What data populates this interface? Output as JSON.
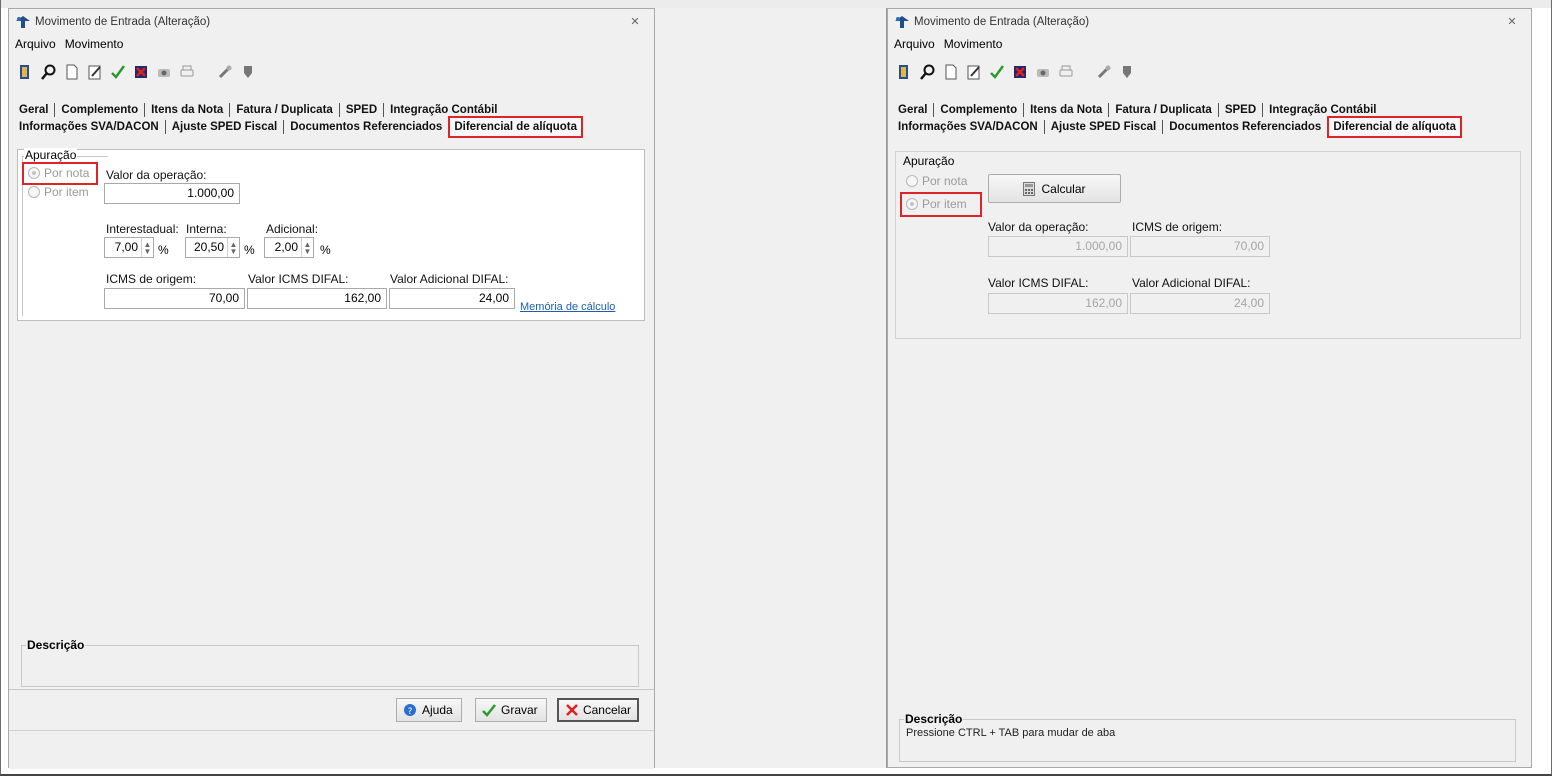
{
  "windows": {
    "left": {
      "title": "Movimento de Entrada (Alteração)",
      "menu": [
        "Arquivo",
        "Movimento"
      ],
      "tabs_row1": [
        "Geral",
        "Complemento",
        "Itens da Nota",
        "Fatura / Duplicata",
        "SPED",
        "Integração Contábil"
      ],
      "tabs_row2": [
        "Informações SVA/DACON",
        "Ajuste SPED Fiscal",
        "Documentos Referenciados",
        "Diferencial de alíquota"
      ],
      "group_label": "Apuração",
      "radio_por_nota": "Por nota",
      "radio_por_item": "Por item",
      "selected_radio": "Por nota",
      "label_valor_operacao": "Valor da operação:",
      "valor_operacao": "1.000,00",
      "label_interestadual": "Interestadual:",
      "interestadual": "7,00",
      "label_interna": "Interna:",
      "interna": "20,50",
      "label_adicional": "Adicional:",
      "adicional": "2,00",
      "percent_sign": "%",
      "label_icms_origem": "ICMS de origem:",
      "icms_origem": "70,00",
      "label_valor_icms_difal": "Valor ICMS DIFAL:",
      "valor_icms_difal": "162,00",
      "label_valor_adicional_difal": "Valor Adicional DIFAL:",
      "valor_adicional_difal": "24,00",
      "memoria_link": "Memória de cálculo",
      "descricao_title": "Descrição",
      "btn_ajuda": "Ajuda",
      "btn_gravar": "Gravar",
      "btn_cancelar": "Cancelar"
    },
    "right": {
      "title": "Movimento de Entrada (Alteração)",
      "menu": [
        "Arquivo",
        "Movimento"
      ],
      "tabs_row1": [
        "Geral",
        "Complemento",
        "Itens da Nota",
        "Fatura / Duplicata",
        "SPED",
        "Integração Contábil"
      ],
      "tabs_row2": [
        "Informações SVA/DACON",
        "Ajuste SPED Fiscal",
        "Documentos Referenciados",
        "Diferencial de alíquota"
      ],
      "group_label": "Apuração",
      "radio_por_nota": "Por nota",
      "radio_por_item": "Por item",
      "selected_radio": "Por item",
      "btn_calcular": "Calcular",
      "label_valor_operacao": "Valor da operação:",
      "valor_operacao": "1.000,00",
      "label_icms_origem": "ICMS de origem:",
      "icms_origem": "70,00",
      "label_valor_icms_difal": "Valor ICMS DIFAL:",
      "valor_icms_difal": "162,00",
      "label_valor_adicional_difal": "Valor Adicional DIFAL:",
      "valor_adicional_difal": "24,00",
      "descricao_title": "Descrição",
      "descricao_text": "Pressione CTRL + TAB para mudar de aba"
    }
  },
  "colors": {
    "highlight": "#e0232a",
    "link": "#1a5fb4"
  },
  "toolbar_icons": [
    "exit-icon",
    "search-icon",
    "new-document-icon",
    "edit-icon",
    "confirm-check-icon",
    "delete-icon",
    "camera-icon",
    "print-icon",
    "tools-icon",
    "stamp-icon"
  ]
}
